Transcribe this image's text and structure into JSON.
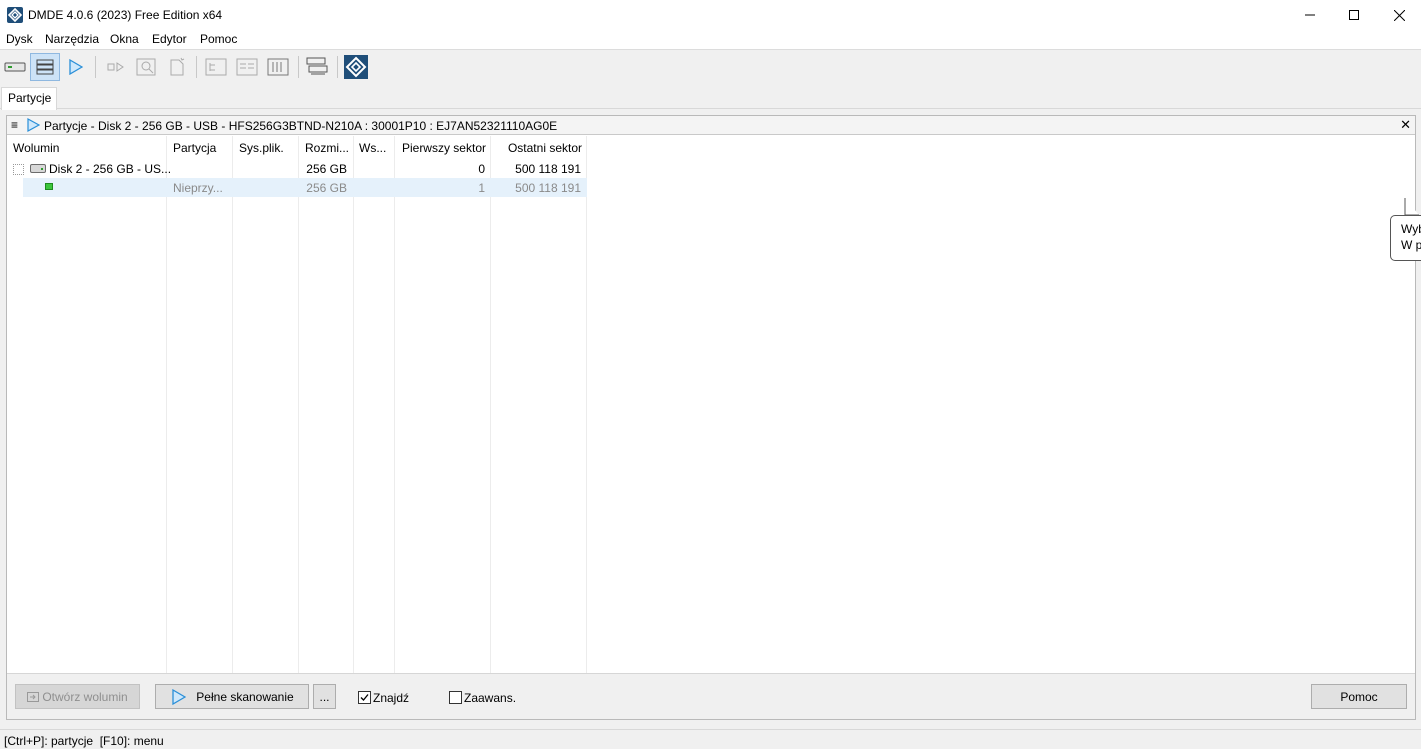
{
  "window": {
    "title": "DMDE 4.0.6 (2023) Free Edition x64"
  },
  "menu": [
    "Dysk",
    "Narzędzia",
    "Okna",
    "Edytor",
    "Pomoc"
  ],
  "tabs": [
    {
      "label": "Partycje",
      "active": true
    }
  ],
  "panel": {
    "title": "Partycje - Disk 2 - 256 GB - USB - HFS256G3BTND-N210A : 30001P10 : EJ7AN52321110AG0E",
    "columns": [
      "Wolumin",
      "Partycja",
      "Sys.plik.",
      "Rozmi...",
      "Ws...",
      "Pierwszy sektor",
      "Ostatni sektor"
    ],
    "rows": [
      {
        "wolumin": "Disk 2 - 256 GB - US...",
        "partycja": "",
        "sys": "",
        "rozmiar": "256 GB",
        "ws": "",
        "pierwszy": "0",
        "ostatni": "500 118 191",
        "icon": "disk-icon"
      },
      {
        "wolumin": "",
        "partycja": "Nieprzy...",
        "sys": "",
        "rozmiar": "256 GB",
        "ws": "",
        "pierwszy": "1",
        "ostatni": "500 118 191",
        "icon": "partition-icon",
        "selected": true
      }
    ]
  },
  "buttons": {
    "open_volume": "Otwórz wolumin",
    "full_scan": "Pełne skanowanie",
    "more": "...",
    "help": "Pomoc"
  },
  "checkboxes": {
    "find": {
      "label": "Znajdź",
      "checked": true
    },
    "advanced": {
      "label": "Zaawans.",
      "checked": false
    }
  },
  "status": "[Ctrl+P]: partycje  [F10]: menu",
  "tooltip": {
    "line1": "Wyb",
    "line2": "W p"
  },
  "colors": {
    "accent": "#1f4e79",
    "selection": "#e5f1fb",
    "play": "#2a8fd8"
  }
}
